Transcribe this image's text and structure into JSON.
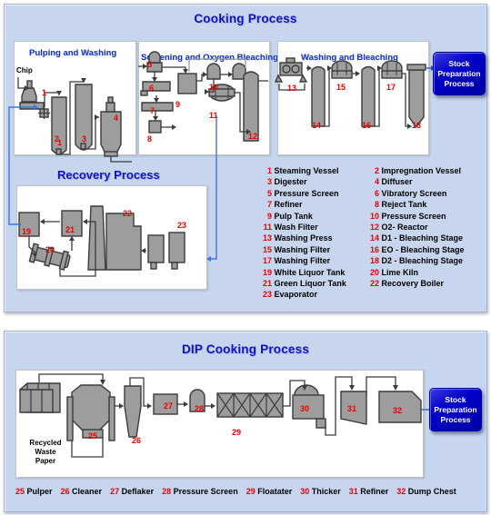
{
  "page": {
    "background": "#ffffff",
    "panel_color": "#c7d6ee",
    "accent_title_color": "#1111cc",
    "number_color": "#ee0000",
    "equipment_fill": "#9d9d9d",
    "flow_line_color": "#3b3b3b",
    "liquor_line_color": "#3a78d8"
  },
  "cooking": {
    "title": "Cooking Process",
    "sections": [
      {
        "id": "pulping",
        "title": "Pulping and Washing"
      },
      {
        "id": "screening",
        "title": "Screening and Oxygen Bleaching"
      },
      {
        "id": "washing",
        "title": "Washing and Bleaching"
      },
      {
        "id": "recovery",
        "title": "Recovery Process"
      }
    ],
    "input_label": "Chip",
    "output_box": "Stock\nPreparation\nProcess",
    "output_box_lines": [
      "Stock",
      "Preparation",
      "Process"
    ],
    "equipment_numbers": [
      "1",
      "2",
      "3",
      "4",
      "5",
      "6",
      "7",
      "8",
      "9",
      "10",
      "11",
      "12",
      "13",
      "14",
      "15",
      "16",
      "17",
      "18",
      "19",
      "20",
      "21",
      "22",
      "23"
    ],
    "legend": [
      {
        "num": "1",
        "name": "Steaming Vessel"
      },
      {
        "num": "2",
        "name": "Impregnation Vessel"
      },
      {
        "num": "3",
        "name": "Digester"
      },
      {
        "num": "4",
        "name": "Diffuser"
      },
      {
        "num": "5",
        "name": "Pressure Screen"
      },
      {
        "num": "6",
        "name": "Vibratory Screen"
      },
      {
        "num": "7",
        "name": "Refiner"
      },
      {
        "num": "8",
        "name": "Reject Tank"
      },
      {
        "num": "9",
        "name": "Pulp Tank"
      },
      {
        "num": "10",
        "name": "Pressure Screen"
      },
      {
        "num": "11",
        "name": "Wash Filter"
      },
      {
        "num": "12",
        "name": "O2- Reactor"
      },
      {
        "num": "13",
        "name": "Washing Press"
      },
      {
        "num": "14",
        "name": "D1 - Bleaching Stage"
      },
      {
        "num": "15",
        "name": "Washing Filter"
      },
      {
        "num": "16",
        "name": "EO - Bleaching Stage"
      },
      {
        "num": "17",
        "name": "Washing Filter"
      },
      {
        "num": "18",
        "name": "D2 - Bleaching Stage"
      },
      {
        "num": "19",
        "name": "White Liquor Tank"
      },
      {
        "num": "20",
        "name": "Lime Kiln"
      },
      {
        "num": "21",
        "name": "Green Liquor Tank"
      },
      {
        "num": "22",
        "name": "Recovery Boiler"
      },
      {
        "num": "23",
        "name": "Evaporator"
      }
    ]
  },
  "dip": {
    "title": "DIP Cooking Process",
    "input_label_lines": [
      "Recycled",
      "Waste",
      "Paper"
    ],
    "output_box_lines": [
      "Stock",
      "Preparation",
      "Process"
    ],
    "equipment_numbers": [
      "25",
      "26",
      "27",
      "28",
      "29",
      "30",
      "31",
      "32"
    ],
    "legend": [
      {
        "num": "25",
        "name": "Pulper"
      },
      {
        "num": "26",
        "name": "Cleaner"
      },
      {
        "num": "27",
        "name": "Deflaker"
      },
      {
        "num": "28",
        "name": "Pressure Screen"
      },
      {
        "num": "29",
        "name": "Floatater"
      },
      {
        "num": "30",
        "name": "Thicker"
      },
      {
        "num": "31",
        "name": "Refiner"
      },
      {
        "num": "32",
        "name": "Dump Chest"
      }
    ]
  }
}
